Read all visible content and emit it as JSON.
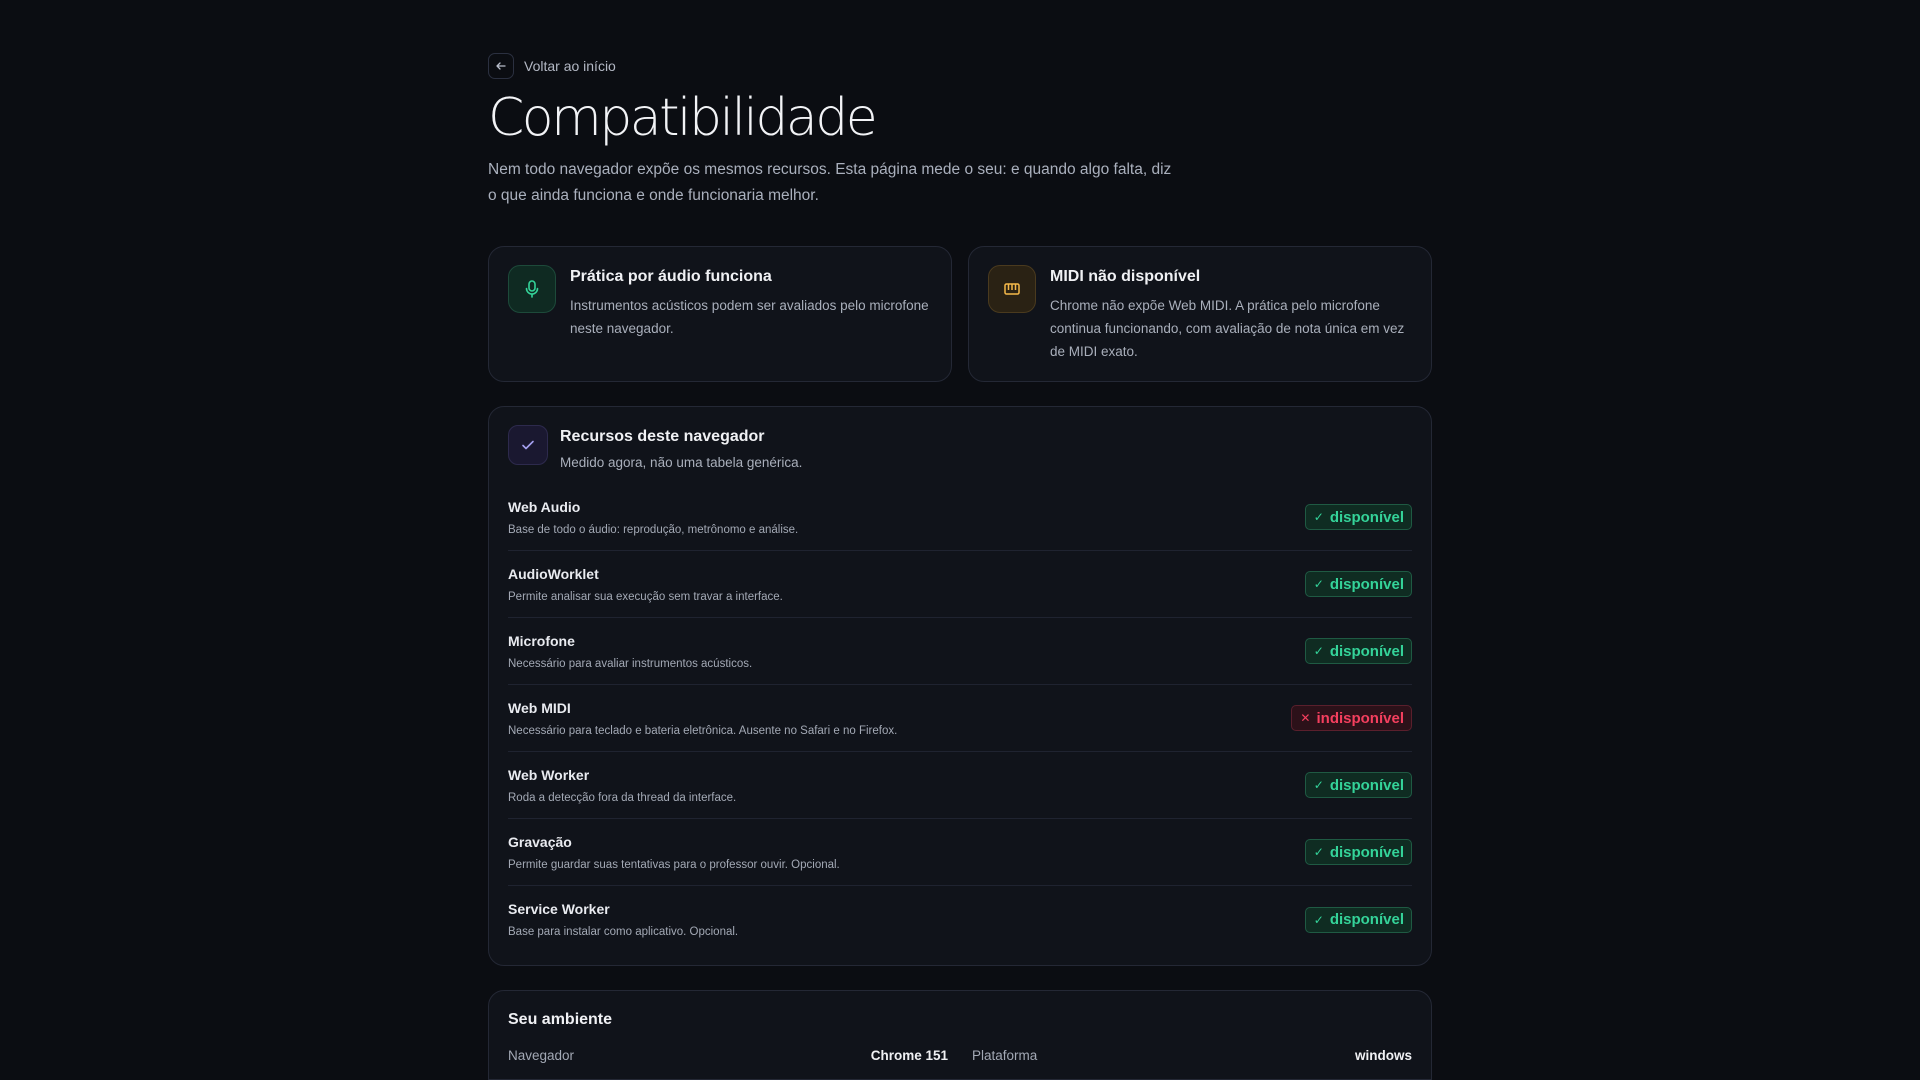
{
  "nav": {
    "back_label": "Voltar ao início",
    "back_icon": "arrow-left-icon"
  },
  "page": {
    "title": "Compatibilidade",
    "intro": "Nem todo navegador expõe os mesmos recursos. Esta página mede o seu: e quando algo falta, diz o que ainda funciona e onde funcionaria melhor."
  },
  "cards": [
    {
      "icon": "microphone-icon",
      "accent": "#34d399",
      "title": "Prática por áudio funciona",
      "text": "Instrumentos acústicos podem ser avaliados pelo microfone neste navegador."
    },
    {
      "icon": "piano-keyboard-icon",
      "accent": "#f5b94a",
      "title": "MIDI não disponível",
      "text": "Chrome não expõe Web MIDI. A prática pelo microfone continua funcionando, com avaliação de nota única em vez de MIDI exato."
    }
  ],
  "resources": {
    "icon": "check-icon",
    "title": "Recursos deste navegador",
    "subtitle": "Medido agora, não uma tabela genérica.",
    "items": [
      {
        "name": "Web Audio",
        "desc": "Base de todo o áudio: reprodução, metrônomo e análise.",
        "status": "disponível",
        "ok": true
      },
      {
        "name": "AudioWorklet",
        "desc": "Permite analisar sua execução sem travar a interface.",
        "status": "disponível",
        "ok": true
      },
      {
        "name": "Microfone",
        "desc": "Necessário para avaliar instrumentos acústicos.",
        "status": "disponível",
        "ok": true
      },
      {
        "name": "Web MIDI",
        "desc": "Necessário para teclado e bateria eletrônica. Ausente no Safari e no Firefox.",
        "status": "indisponível",
        "ok": false
      },
      {
        "name": "Web Worker",
        "desc": "Roda a detecção fora da thread da interface.",
        "status": "disponível",
        "ok": true
      },
      {
        "name": "Gravação",
        "desc": "Permite guardar suas tentativas para o professor ouvir. Opcional.",
        "status": "disponível",
        "ok": true
      },
      {
        "name": "Service Worker",
        "desc": "Base para instalar como aplicativo. Opcional.",
        "status": "disponível",
        "ok": true
      }
    ]
  },
  "environment": {
    "title": "Seu ambiente",
    "browser_label": "Navegador",
    "browser_value": "Chrome 151",
    "platform_label": "Plataforma",
    "platform_value": "windows"
  },
  "colors": {
    "ok": "#34d399",
    "error": "#f43f5e",
    "background": "#0b0d12"
  }
}
